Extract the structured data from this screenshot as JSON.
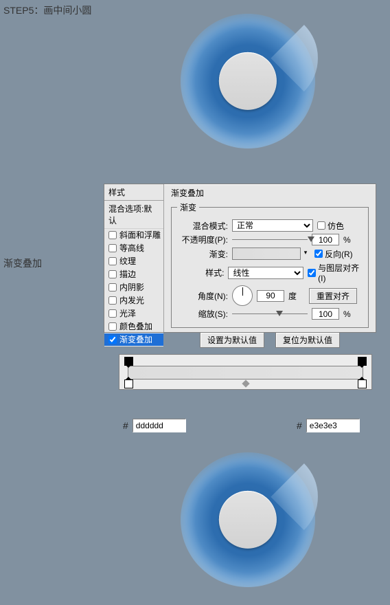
{
  "step_title": "STEP5：画中间小圆",
  "side_label": "渐变叠加",
  "panel": {
    "left_head": "样式",
    "blend_defaults": "混合选项:默认",
    "items": [
      {
        "label": "斜面和浮雕",
        "checked": false,
        "sub": false
      },
      {
        "label": "等高线",
        "checked": false,
        "sub": true
      },
      {
        "label": "纹理",
        "checked": false,
        "sub": true
      },
      {
        "label": "描边",
        "checked": false,
        "sub": false
      },
      {
        "label": "内阴影",
        "checked": false,
        "sub": false
      },
      {
        "label": "内发光",
        "checked": false,
        "sub": false
      },
      {
        "label": "光泽",
        "checked": false,
        "sub": false
      },
      {
        "label": "颜色叠加",
        "checked": false,
        "sub": false
      },
      {
        "label": "渐变叠加",
        "checked": true,
        "sub": false,
        "selected": true
      }
    ]
  },
  "right": {
    "section_title": "渐变叠加",
    "group_title": "渐变",
    "blend_mode_label": "混合模式:",
    "blend_mode_value": "正常",
    "dither_label": "仿色",
    "dither_checked": false,
    "opacity_label": "不透明度(P):",
    "opacity_value": "100",
    "pct": "%",
    "gradient_label": "渐变:",
    "reverse_label": "反向(R)",
    "reverse_checked": true,
    "style_label": "样式:",
    "style_value": "线性",
    "align_label": "与图层对齐(I)",
    "align_checked": true,
    "angle_label": "角度(N):",
    "angle_value": "90",
    "degree": "度",
    "reset_align": "重置对齐",
    "scale_label": "缩放(S):",
    "scale_value": "100",
    "btn_set_default": "设置为默认值",
    "btn_reset_default": "复位为默认值"
  },
  "color1_hex": "dddddd",
  "color2_hex": "e3e3e3"
}
